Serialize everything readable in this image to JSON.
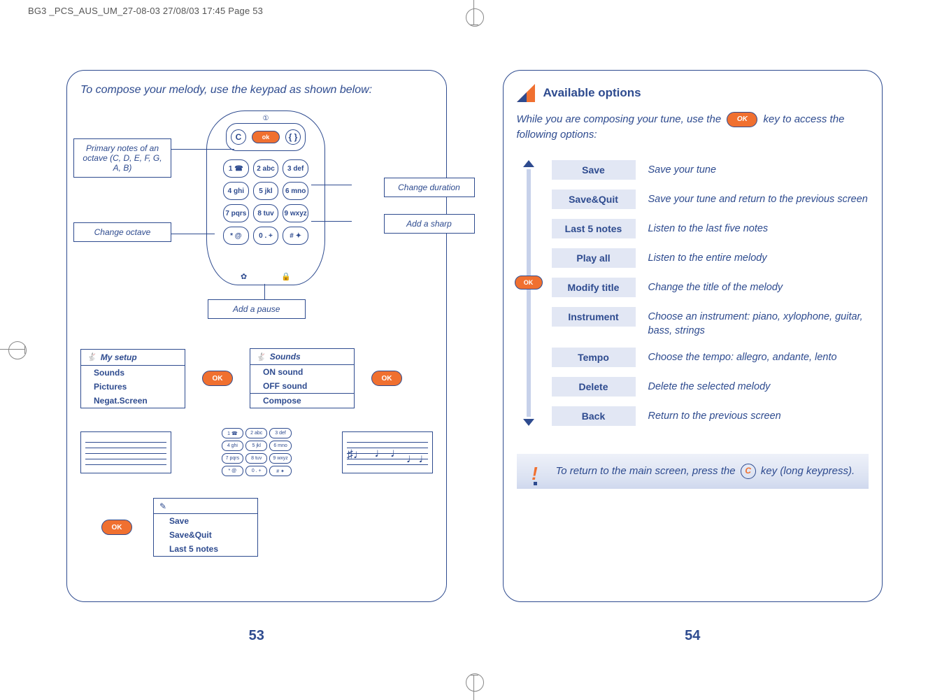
{
  "print_header": "BG3 _PCS_AUS_UM_27-08-03  27/08/03  17:45  Page 53",
  "left": {
    "lead": "To compose your melody, use the keypad as shown below:",
    "callouts": {
      "primary_notes": "Primary notes of an octave (C, D, E, F, G, A, B)",
      "change_octave": "Change octave",
      "change_duration": "Change duration",
      "add_sharp": "Add a sharp",
      "add_pause": "Add a pause"
    },
    "phone": {
      "soft_left": "C",
      "soft_mid": "ok",
      "soft_right": "{ }",
      "earpiece": "①"
    },
    "keypad": [
      "1 ☎",
      "2 abc",
      "3 def",
      "4 ghi",
      "5 jkl",
      "6 mno",
      "7 pqrs",
      "8 tuv",
      "9 wxyz",
      "* @",
      "0 . +",
      "# ✦"
    ],
    "bottom_icons": [
      "✿",
      "🔒"
    ],
    "menu1": {
      "title": "My setup",
      "items": [
        "Sounds",
        "Pictures",
        "Negat.Screen"
      ]
    },
    "menu2": {
      "title": "Sounds",
      "items": [
        "ON sound",
        "OFF sound",
        "Compose"
      ]
    },
    "ok_label": "OK",
    "save_menu": {
      "items": [
        "Save",
        "Save&Quit",
        "Last 5 notes"
      ]
    },
    "page_num": "53"
  },
  "right": {
    "section_title": "Available options",
    "intro_a": "While you are composing your tune, use the ",
    "intro_b": " key to access the following options:",
    "ok_label": "OK",
    "options": [
      {
        "label": "Save",
        "desc": "Save your tune"
      },
      {
        "label": "Save&Quit",
        "desc": "Save your tune and return to the previous screen"
      },
      {
        "label": "Last 5 notes",
        "desc": "Listen to the last five notes"
      },
      {
        "label": "Play all",
        "desc": "Listen to the entire melody"
      },
      {
        "label": "Modify title",
        "desc": "Change the title of the melody"
      },
      {
        "label": "Instrument",
        "desc": "Choose an instrument: piano, xylophone, guitar, bass, strings"
      },
      {
        "label": "Tempo",
        "desc": "Choose the tempo: allegro, andante, lento"
      },
      {
        "label": "Delete",
        "desc": "Delete the selected melody"
      },
      {
        "label": "Back",
        "desc": "Return to the previous screen"
      }
    ],
    "tip_a": "To return to the main screen, press the ",
    "tip_b": " key (long keypress).",
    "c_key": "C",
    "page_num": "54"
  }
}
